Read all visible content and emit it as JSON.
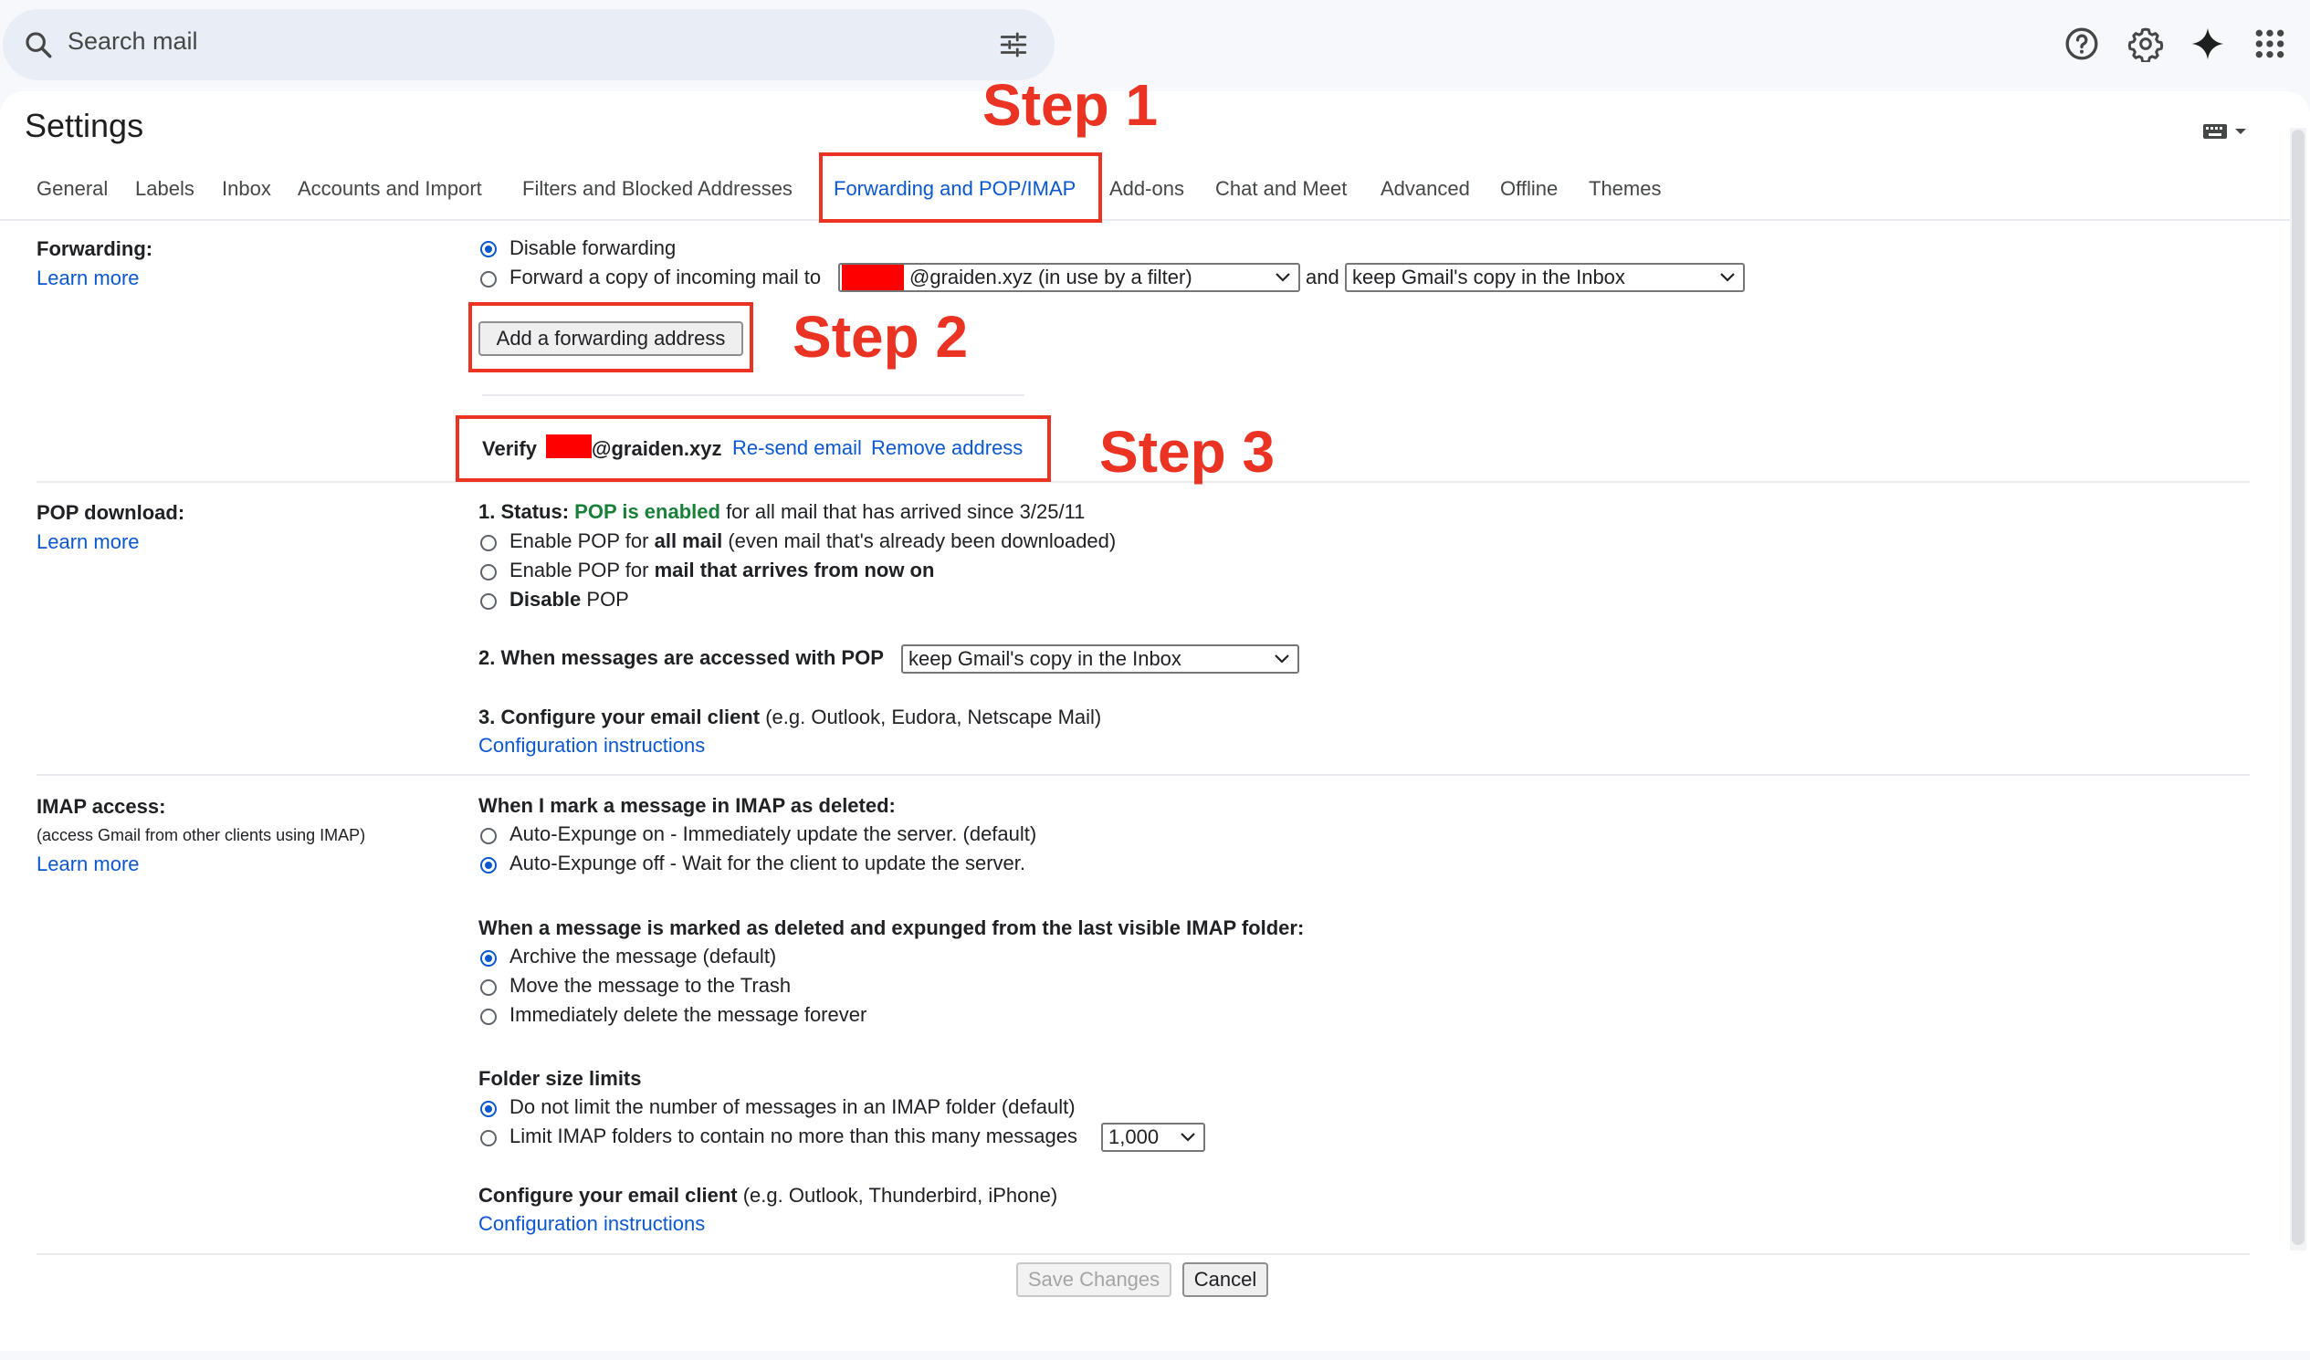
{
  "search": {
    "placeholder": "Search mail"
  },
  "header": {
    "title": "Settings"
  },
  "tabs": [
    {
      "label": "General"
    },
    {
      "label": "Labels"
    },
    {
      "label": "Inbox"
    },
    {
      "label": "Accounts and Import"
    },
    {
      "label": "Filters and Blocked Addresses"
    },
    {
      "label": "Forwarding and POP/IMAP"
    },
    {
      "label": "Add-ons"
    },
    {
      "label": "Chat and Meet"
    },
    {
      "label": "Advanced"
    },
    {
      "label": "Offline"
    },
    {
      "label": "Themes"
    }
  ],
  "active_tab": "Forwarding and POP/IMAP",
  "forwarding": {
    "label": "Forwarding:",
    "learn_more": "Learn more",
    "disable_option": "Disable forwarding",
    "forward_option": "Forward a copy of incoming mail to",
    "address_select": "@graiden.xyz (in use by a filter)",
    "and": "and",
    "action_select": "keep Gmail's copy in the Inbox",
    "add_button": "Add a forwarding address",
    "verify_label": "Verify",
    "verify_domain": "@graiden.xyz",
    "resend": "Re-send email",
    "remove": "Remove address"
  },
  "pop": {
    "label": "POP download:",
    "learn_more": "Learn more",
    "status_prefix": "1. Status:",
    "status_value": "POP is enabled",
    "status_suffix": "for all mail that has arrived since 3/25/11",
    "opt1_a": "Enable POP for",
    "opt1_b": "all mail",
    "opt1_c": "(even mail that's already been downloaded)",
    "opt2_a": "Enable POP for",
    "opt2_b": "mail that arrives from now on",
    "opt3_a": "Disable",
    "opt3_b": "POP",
    "when_label": "2. When messages are accessed with POP",
    "when_select": "keep Gmail's copy in the Inbox",
    "configure_bold": "3. Configure your email client",
    "configure_rest": "(e.g. Outlook, Eudora, Netscape Mail)",
    "config_link": "Configuration instructions"
  },
  "imap": {
    "label": "IMAP access:",
    "sublabel": "(access Gmail from other clients using IMAP)",
    "learn_more": "Learn more",
    "deleted_heading": "When I mark a message in IMAP as deleted:",
    "expunge_on": "Auto-Expunge on - Immediately update the server. (default)",
    "expunge_off": "Auto-Expunge off - Wait for the client to update the server.",
    "expunged_heading": "When a message is marked as deleted and expunged from the last visible IMAP folder:",
    "archive": "Archive the message (default)",
    "trash": "Move the message to the Trash",
    "delete_forever": "Immediately delete the message forever",
    "folder_heading": "Folder size limits",
    "no_limit": "Do not limit the number of messages in an IMAP folder (default)",
    "limit": "Limit IMAP folders to contain no more than this many messages",
    "limit_select": "1,000",
    "configure_bold": "Configure your email client",
    "configure_rest": "(e.g. Outlook, Thunderbird, iPhone)",
    "config_link": "Configuration instructions"
  },
  "footer": {
    "save": "Save Changes",
    "cancel": "Cancel"
  },
  "annotations": {
    "step1": "Step 1",
    "step2": "Step 2",
    "step3": "Step 3"
  },
  "icons": {
    "search": "search-icon",
    "tune": "tune-icon",
    "help": "help-icon",
    "settings": "gear-icon",
    "gemini": "sparkle-icon",
    "apps": "apps-grid-icon",
    "keyboard": "keyboard-icon"
  },
  "colors": {
    "accent": "#0b57d0",
    "annotation": "#ea3323",
    "status_green": "#188038",
    "redaction": "#fe0000"
  }
}
